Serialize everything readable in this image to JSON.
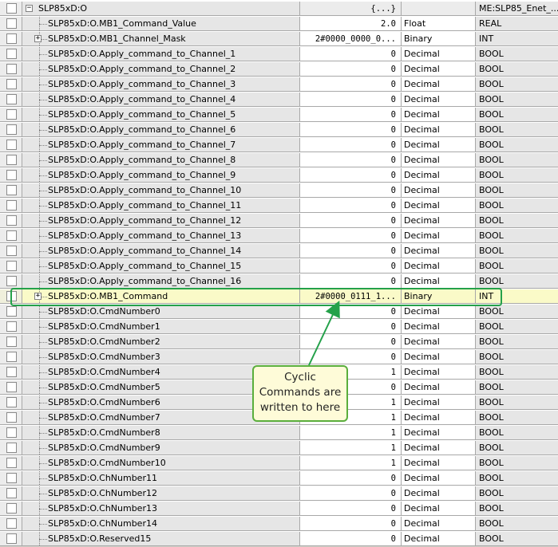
{
  "root": {
    "name": "SLP85xD:O",
    "value": "{...}",
    "style": "",
    "type": "ME:SLP85_Enet_..."
  },
  "rows": [
    {
      "name": "SLP85xD:O.MB1_Command_Value",
      "value": "2.0",
      "style": "Float",
      "type": "REAL",
      "expand": false
    },
    {
      "name": "SLP85xD:O.MB1_Channel_Mask",
      "value": "2#0000_0000_0...",
      "style": "Binary",
      "type": "INT",
      "expand": true
    },
    {
      "name": "SLP85xD:O.Apply_command_to_Channel_1",
      "value": "0",
      "style": "Decimal",
      "type": "BOOL",
      "expand": false
    },
    {
      "name": "SLP85xD:O.Apply_command_to_Channel_2",
      "value": "0",
      "style": "Decimal",
      "type": "BOOL",
      "expand": false
    },
    {
      "name": "SLP85xD:O.Apply_command_to_Channel_3",
      "value": "0",
      "style": "Decimal",
      "type": "BOOL",
      "expand": false
    },
    {
      "name": "SLP85xD:O.Apply_command_to_Channel_4",
      "value": "0",
      "style": "Decimal",
      "type": "BOOL",
      "expand": false
    },
    {
      "name": "SLP85xD:O.Apply_command_to_Channel_5",
      "value": "0",
      "style": "Decimal",
      "type": "BOOL",
      "expand": false
    },
    {
      "name": "SLP85xD:O.Apply_command_to_Channel_6",
      "value": "0",
      "style": "Decimal",
      "type": "BOOL",
      "expand": false
    },
    {
      "name": "SLP85xD:O.Apply_command_to_Channel_7",
      "value": "0",
      "style": "Decimal",
      "type": "BOOL",
      "expand": false
    },
    {
      "name": "SLP85xD:O.Apply_command_to_Channel_8",
      "value": "0",
      "style": "Decimal",
      "type": "BOOL",
      "expand": false
    },
    {
      "name": "SLP85xD:O.Apply_command_to_Channel_9",
      "value": "0",
      "style": "Decimal",
      "type": "BOOL",
      "expand": false
    },
    {
      "name": "SLP85xD:O.Apply_command_to_Channel_10",
      "value": "0",
      "style": "Decimal",
      "type": "BOOL",
      "expand": false
    },
    {
      "name": "SLP85xD:O.Apply_command_to_Channel_11",
      "value": "0",
      "style": "Decimal",
      "type": "BOOL",
      "expand": false
    },
    {
      "name": "SLP85xD:O.Apply_command_to_Channel_12",
      "value": "0",
      "style": "Decimal",
      "type": "BOOL",
      "expand": false
    },
    {
      "name": "SLP85xD:O.Apply_command_to_Channel_13",
      "value": "0",
      "style": "Decimal",
      "type": "BOOL",
      "expand": false
    },
    {
      "name": "SLP85xD:O.Apply_command_to_Channel_14",
      "value": "0",
      "style": "Decimal",
      "type": "BOOL",
      "expand": false
    },
    {
      "name": "SLP85xD:O.Apply_command_to_Channel_15",
      "value": "0",
      "style": "Decimal",
      "type": "BOOL",
      "expand": false
    },
    {
      "name": "SLP85xD:O.Apply_command_to_Channel_16",
      "value": "0",
      "style": "Decimal",
      "type": "BOOL",
      "expand": false
    },
    {
      "name": "SLP85xD:O.MB1_Command",
      "value": "2#0000_0111_1...",
      "style": "Binary",
      "type": "INT",
      "expand": true,
      "highlight": true
    },
    {
      "name": "SLP85xD:O.CmdNumber0",
      "value": "0",
      "style": "Decimal",
      "type": "BOOL",
      "expand": false
    },
    {
      "name": "SLP85xD:O.CmdNumber1",
      "value": "0",
      "style": "Decimal",
      "type": "BOOL",
      "expand": false
    },
    {
      "name": "SLP85xD:O.CmdNumber2",
      "value": "0",
      "style": "Decimal",
      "type": "BOOL",
      "expand": false
    },
    {
      "name": "SLP85xD:O.CmdNumber3",
      "value": "0",
      "style": "Decimal",
      "type": "BOOL",
      "expand": false
    },
    {
      "name": "SLP85xD:O.CmdNumber4",
      "value": "1",
      "style": "Decimal",
      "type": "BOOL",
      "expand": false
    },
    {
      "name": "SLP85xD:O.CmdNumber5",
      "value": "0",
      "style": "Decimal",
      "type": "BOOL",
      "expand": false
    },
    {
      "name": "SLP85xD:O.CmdNumber6",
      "value": "1",
      "style": "Decimal",
      "type": "BOOL",
      "expand": false
    },
    {
      "name": "SLP85xD:O.CmdNumber7",
      "value": "1",
      "style": "Decimal",
      "type": "BOOL",
      "expand": false
    },
    {
      "name": "SLP85xD:O.CmdNumber8",
      "value": "1",
      "style": "Decimal",
      "type": "BOOL",
      "expand": false
    },
    {
      "name": "SLP85xD:O.CmdNumber9",
      "value": "1",
      "style": "Decimal",
      "type": "BOOL",
      "expand": false
    },
    {
      "name": "SLP85xD:O.CmdNumber10",
      "value": "1",
      "style": "Decimal",
      "type": "BOOL",
      "expand": false
    },
    {
      "name": "SLP85xD:O.ChNumber11",
      "value": "0",
      "style": "Decimal",
      "type": "BOOL",
      "expand": false
    },
    {
      "name": "SLP85xD:O.ChNumber12",
      "value": "0",
      "style": "Decimal",
      "type": "BOOL",
      "expand": false
    },
    {
      "name": "SLP85xD:O.ChNumber13",
      "value": "0",
      "style": "Decimal",
      "type": "BOOL",
      "expand": false
    },
    {
      "name": "SLP85xD:O.ChNumber14",
      "value": "0",
      "style": "Decimal",
      "type": "BOOL",
      "expand": false
    },
    {
      "name": "SLP85xD:O.Reserved15",
      "value": "0",
      "style": "Decimal",
      "type": "BOOL",
      "expand": false
    }
  ],
  "callout": {
    "lines": [
      "Cyclic",
      "Commands are",
      "written to here"
    ]
  },
  "colors": {
    "highlight_outline": "#24a14a",
    "callout_border": "#5aae3c",
    "callout_fill": "#fefbd8",
    "row_highlight": "#fafac8"
  }
}
